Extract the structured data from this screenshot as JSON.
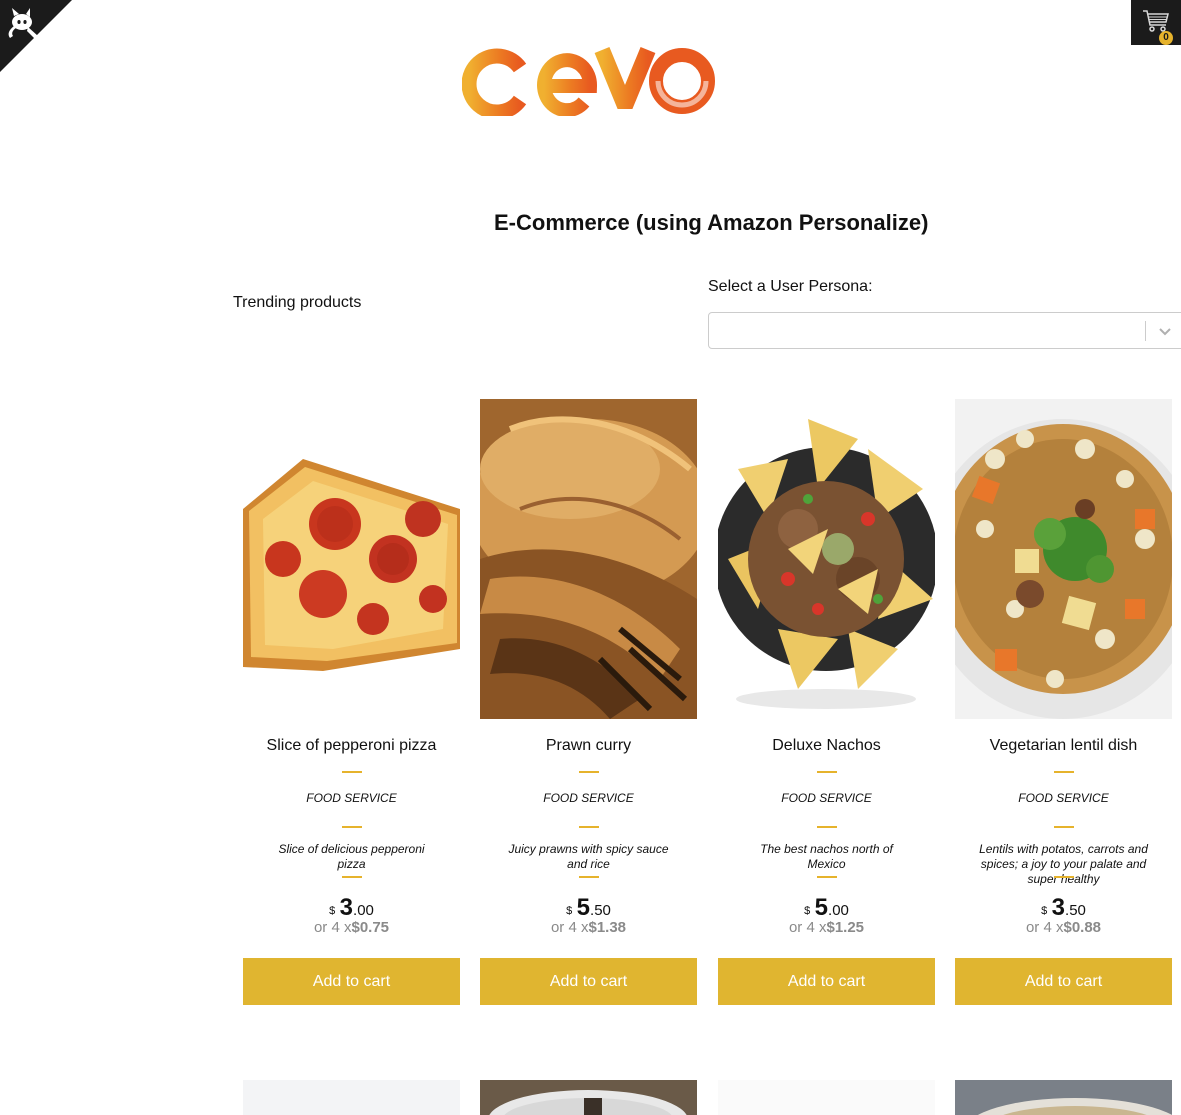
{
  "header": {
    "cart_count": "0",
    "logo_text": "cevo"
  },
  "page": {
    "title": "E-Commerce (using Amazon Personalize)",
    "section_title": "Trending products"
  },
  "persona": {
    "label": "Select a User Persona:",
    "value": ""
  },
  "products": [
    {
      "name": "Slice of pepperoni pizza",
      "category": "FOOD SERVICE",
      "description": "Slice of delicious pepperoni pizza",
      "currency": "$",
      "price_int": "3",
      "price_dec": ".00",
      "installment_prefix": "or 4 x",
      "installment": "$0.75",
      "button": "Add to cart",
      "image": "pepperoni-pizza-slice"
    },
    {
      "name": "Prawn curry",
      "category": "FOOD SERVICE",
      "description": "Juicy prawns with spicy sauce and rice",
      "currency": "$",
      "price_int": "5",
      "price_dec": ".50",
      "installment_prefix": "or 4 x",
      "installment": "$1.38",
      "button": "Add to cart",
      "image": "grilled-prawns"
    },
    {
      "name": "Deluxe Nachos",
      "category": "FOOD SERVICE",
      "description": "The best nachos north of Mexico",
      "currency": "$",
      "price_int": "5",
      "price_dec": ".00",
      "installment_prefix": "or 4 x",
      "installment": "$1.25",
      "button": "Add to cart",
      "image": "nachos-plate"
    },
    {
      "name": "Vegetarian lentil dish",
      "category": "FOOD SERVICE",
      "description": "Lentils with potatos, carrots and spices; a joy to your palate and super healthy",
      "currency": "$",
      "price_int": "3",
      "price_dec": ".50",
      "installment_prefix": "or 4 x",
      "installment": "$0.88",
      "button": "Add to cart",
      "image": "lentil-stew"
    }
  ],
  "colors": {
    "accent": "#e0b530",
    "dark": "#1b1b1b",
    "logo_gradient": [
      "#f0b030",
      "#e85a20"
    ]
  }
}
